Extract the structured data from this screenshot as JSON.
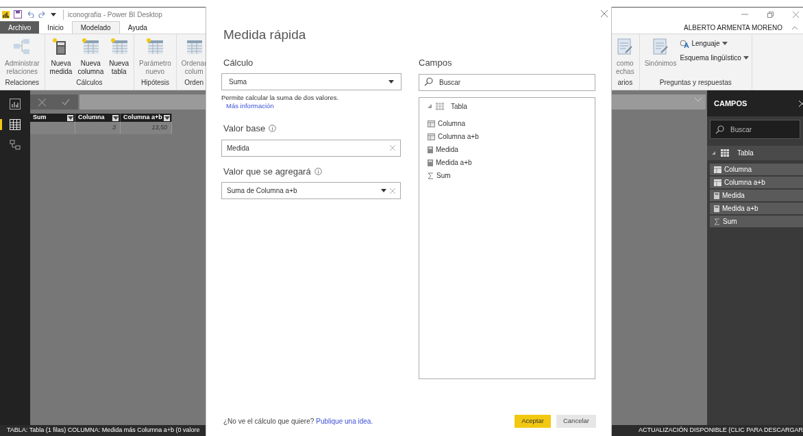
{
  "title_bar": {
    "title": "iconografia - Power BI Desktop"
  },
  "ribbon_tabs": [
    {
      "label": "Archivo",
      "kind": "file",
      "selected": false
    },
    {
      "label": "Inicio",
      "kind": "tab",
      "selected": false
    },
    {
      "label": "Modelado",
      "kind": "tab",
      "selected": true
    },
    {
      "label": "Ayuda",
      "kind": "tab",
      "selected": false
    }
  ],
  "user": "ALBERTO ARMENTA MORENO",
  "ribbon_groups_left": [
    {
      "label": "Relaciones",
      "buttons": [
        {
          "lines": [
            "Administrar",
            "relaciones"
          ],
          "disabled": true
        }
      ]
    },
    {
      "label": "Cálculos",
      "buttons": [
        {
          "lines": [
            "Nueva",
            "medida"
          ],
          "disabled": false
        },
        {
          "lines": [
            "Nueva",
            "columna"
          ],
          "disabled": false
        },
        {
          "lines": [
            "Nueva",
            "tabla"
          ],
          "disabled": false
        }
      ]
    },
    {
      "label": "Hipótesis",
      "buttons": [
        {
          "lines": [
            "Parámetro",
            "nuevo"
          ],
          "disabled": true
        }
      ]
    },
    {
      "label": "Orden",
      "buttons": [
        {
          "lines": [
            "Ordenar",
            "colum"
          ],
          "disabled": true
        }
      ]
    }
  ],
  "ribbon_groups_right": [
    {
      "label": "arios",
      "buttons": [
        {
          "lines": [
            "como",
            "echas"
          ],
          "disabled": true
        }
      ]
    },
    {
      "label": "Preguntas y respuestas",
      "buttons": [
        {
          "lines": [
            "Sinónimos"
          ],
          "disabled": true
        }
      ],
      "small_buttons": [
        "Lenguaje",
        "Esquema lingüístico"
      ]
    }
  ],
  "table": {
    "columns": [
      "Sum",
      "Columna",
      "Columna a+b"
    ],
    "rows": [
      {
        "cells": {
          "1": "3",
          "2": "13,50"
        }
      }
    ]
  },
  "fields_pane": {
    "title": "CAMPOS",
    "search": {
      "placeholder": "Buscar"
    },
    "tables": [
      {
        "name": "Tabla",
        "expanded": true,
        "children": [
          {
            "name": "Columna",
            "kind": "column"
          },
          {
            "name": "Columna a+b",
            "kind": "column"
          },
          {
            "name": "Medida",
            "kind": "measure"
          },
          {
            "name": "Medida a+b",
            "kind": "measure"
          },
          {
            "name": "Sum",
            "kind": "sum"
          }
        ]
      }
    ]
  },
  "status_bar": {
    "left": "TABLA: Tabla (1 filas) COLUMNA: Medida más Columna a+b (0 valore",
    "right": "ACTUALIZACIÓN DISPONIBLE (CLIC PARA DESCARGAR"
  },
  "dialog": {
    "title": "Medida rápida",
    "calculation": {
      "label": "Cálculo",
      "value": "Suma",
      "description": "Permite calcular la suma de dos valores.",
      "link": "Más información"
    },
    "base_value": {
      "label": "Valor base",
      "value": "Medida"
    },
    "added_value": {
      "label": "Valor que se agregará",
      "value": "Suma de Columna a+b"
    },
    "fields": {
      "label": "Campos",
      "search": {
        "placeholder": "Buscar"
      },
      "tables": [
        {
          "name": "Tabla",
          "expanded": true,
          "children": [
            {
              "name": "Columna",
              "kind": "column"
            },
            {
              "name": "Columna a+b",
              "kind": "column"
            },
            {
              "name": "Medida",
              "kind": "measure"
            },
            {
              "name": "Medida a+b",
              "kind": "measure"
            },
            {
              "name": "Sum",
              "kind": "sum"
            }
          ]
        }
      ]
    },
    "footer_text": "¿No ve el cálculo que quiere?",
    "footer_link": "Publique una idea.",
    "buttons": [
      {
        "label": "Aceptar",
        "kind": "primary"
      },
      {
        "label": "Cancelar",
        "kind": "secondary"
      }
    ]
  }
}
